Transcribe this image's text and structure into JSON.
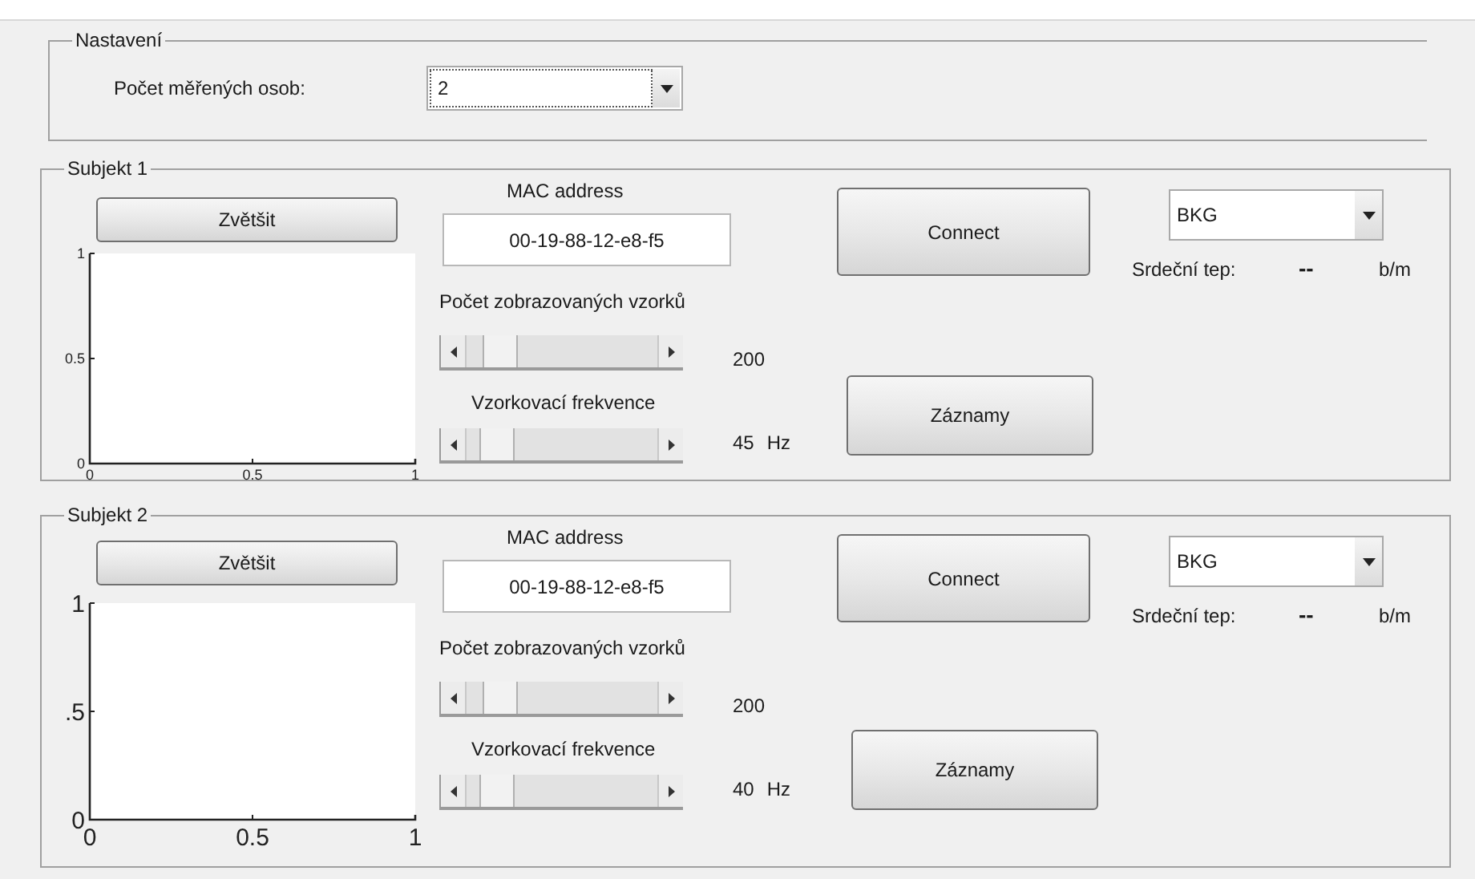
{
  "settings": {
    "title": "Nastavení",
    "count_label": "Počet měřených osob:",
    "count_value": "2"
  },
  "subjects": [
    {
      "title": "Subjekt 1",
      "zoom_button": "Zvětšit",
      "plot": {
        "y_ticks": [
          "1",
          "0.5",
          "0"
        ],
        "x_ticks": [
          "0",
          "0.5",
          "1"
        ]
      },
      "mac_label": "MAC address",
      "mac_value": "00-19-88-12-e8-f5",
      "samples_label": "Počet zobrazovaných vzorků",
      "samples_slider": {
        "level": 0.1
      },
      "samples_value": "200",
      "freq_label": "Vzorkovací frekvence",
      "freq_slider": {
        "level": 0.08
      },
      "freq_value": "45",
      "freq_unit": "Hz",
      "connect_button": "Connect",
      "records_button": "Záznamy",
      "filter_value": "BKG",
      "heart_rate_label": "Srdeční tep:",
      "heart_rate_value": "--",
      "heart_rate_unit": "b/m"
    },
    {
      "title": "Subjekt 2",
      "zoom_button": "Zvětšit",
      "plot": {
        "y_ticks": [
          "1",
          ".5",
          "0"
        ],
        "x_ticks": [
          "0",
          "0.5",
          "1"
        ]
      },
      "mac_label": "MAC address",
      "mac_value": "00-19-88-12-e8-f5",
      "samples_label": "Počet zobrazovaných vzorků",
      "samples_slider": {
        "level": 0.1
      },
      "samples_value": "200",
      "freq_label": "Vzorkovací frekvence",
      "freq_slider": {
        "level": 0.08
      },
      "freq_value": "40",
      "freq_unit": "Hz",
      "connect_button": "Connect",
      "records_button": "Záznamy",
      "filter_value": "BKG",
      "heart_rate_label": "Srdeční tep:",
      "heart_rate_value": "--",
      "heart_rate_unit": "b/m"
    }
  ]
}
